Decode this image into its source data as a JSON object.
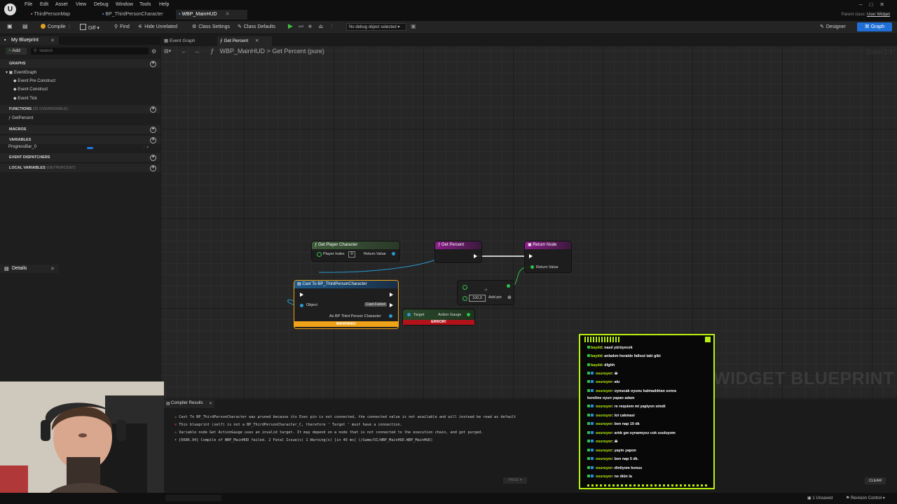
{
  "menu": {
    "items": [
      "File",
      "Edit",
      "Asset",
      "View",
      "Debug",
      "Window",
      "Tools",
      "Help"
    ]
  },
  "tabs": [
    {
      "label": "ThirdPersonMap"
    },
    {
      "label": "BP_ThirdPersonCharacter"
    },
    {
      "label": "WBP_MainHUD"
    }
  ],
  "parent_class": {
    "label": "Parent class:",
    "value": "User Widget"
  },
  "toolbar": {
    "compile": "Compile",
    "diff": "Diff",
    "find": "Find",
    "hide_unrelated": "Hide Unrelated",
    "class_settings": "Class Settings",
    "class_defaults": "Class Defaults",
    "debug_select": "No debug object selected",
    "designer": "Designer",
    "graph": "Graph"
  },
  "left_panel": {
    "tab": "My Blueprint",
    "add": "Add",
    "search_placeholder": "Search",
    "sections": {
      "graphs": "GRAPHS",
      "functions": "FUNCTIONS",
      "functions_note": "(35 OVERRIDABLE)",
      "macros": "MACROS",
      "variables": "VARIABLES",
      "event_dispatchers": "EVENT DISPATCHERS",
      "local_variables": "LOCAL VARIABLES",
      "local_variables_note": "(GETPERCENT)"
    },
    "graph_items": [
      "EventGraph",
      "Event Pre Construct",
      "Event Construct",
      "Event Tick"
    ],
    "function_items": [
      "GetPercent"
    ],
    "variable_items": [
      "ProgressBar_0"
    ]
  },
  "details": {
    "tab": "Details"
  },
  "graph_tabs": [
    "Event Graph",
    "Get Percent"
  ],
  "breadcrumb": {
    "root": "WBP_MainHUD",
    "separator": ">",
    "current": "Get Percent (pure)"
  },
  "zoom": "Zoom 1:1",
  "watermark": "WIDGET BLUEPRINT",
  "nodes": {
    "get_player_character": {
      "title": "Get Player Character",
      "player_index_label": "Player Index",
      "player_index_value": "0",
      "return_value": "Return Value"
    },
    "get_percent": {
      "title": "Get Percent"
    },
    "return_node": {
      "title": "Return Node",
      "return_value": "Return Value"
    },
    "cast": {
      "title": "Cast To BP_ThirdPersonCharacter",
      "object": "Object",
      "cast_failed": "Cast Failed",
      "as_bp": "As BP Third Person Character",
      "warning": "WARNING!"
    },
    "action_gauge": {
      "target": "Target",
      "output": "Action Gauge",
      "error": "ERROR!"
    },
    "divide": {
      "symbol": "÷",
      "value": "100,0",
      "add_pin": "Add pin"
    }
  },
  "compiler": {
    "tab": "Compiler Results",
    "lines": [
      {
        "icon": "warning",
        "text": "Cast To BP_ThirdPersonCharacter was pruned because its Exec pin is not connected, the connected value is not available and will instead be read as default"
      },
      {
        "icon": "error",
        "text": "This blueprint (self) is not a BP_ThirdPersonCharacter_C, therefore ' Target ' must have a connection."
      },
      {
        "icon": "warning",
        "text": "Variable node Get ActionGauge uses an invalid target. It may depend on a node that is not connected to the execution chain, and got purged."
      },
      {
        "icon": "bullet",
        "text": "[6686.94] Compile of WBP_MainHUD failed. 2 Fatal Issue(s) 1 Warning(s) [in 49 ms] (/Game/UI/WBP_MainHUD.WBP_MainHUD)"
      }
    ],
    "page": "PAGE",
    "clear": "CLEAR"
  },
  "chat": {
    "messages": [
      {
        "user": "baydd",
        "text": ": nasıl yürüyecek"
      },
      {
        "user": "baydd",
        "text": ": anladım heralde fallout taki gibi"
      },
      {
        "user": "baydd",
        "text": ": dfghh"
      },
      {
        "user": "osuruyor",
        "text": ": ☠"
      },
      {
        "user": "osuruyor",
        "text": ": alu"
      },
      {
        "user": "osuruyor",
        "text": ": oynucak oyunu kalmadıktan sonra"
      },
      {
        "user": "",
        "text": "kendine oyun yapan adam"
      },
      {
        "user": "osuruyor",
        "text": ": re requiem mi yapiyon simdi"
      },
      {
        "user": "osuruyor",
        "text": ": lol cakmasi"
      },
      {
        "user": "osuruyor",
        "text": ": ben nap 10 dk"
      },
      {
        "user": "osuruyor",
        "text": ": artık gw oynamıyoz cok uzuluyom"
      },
      {
        "user": "osuruyor",
        "text": ": ☠"
      },
      {
        "user": "osuruyor",
        "text": ": yayin yapon"
      },
      {
        "user": "osuruyor",
        "text": ": ben nap 5 dk."
      },
      {
        "user": "osuruyor",
        "text": ": dinliyom konus"
      },
      {
        "user": "osuruyor",
        "text": ": ne diün la"
      }
    ]
  },
  "status": {
    "unsaved": "1 Unsaved",
    "revision": "Revision Control"
  },
  "colors": {
    "accent": "#1f6fd6",
    "chat_border": "#b9f20f",
    "warning_bar": "#f0a318",
    "error_bar": "#b4121a",
    "pure_node_header": "#3e5a3a"
  }
}
